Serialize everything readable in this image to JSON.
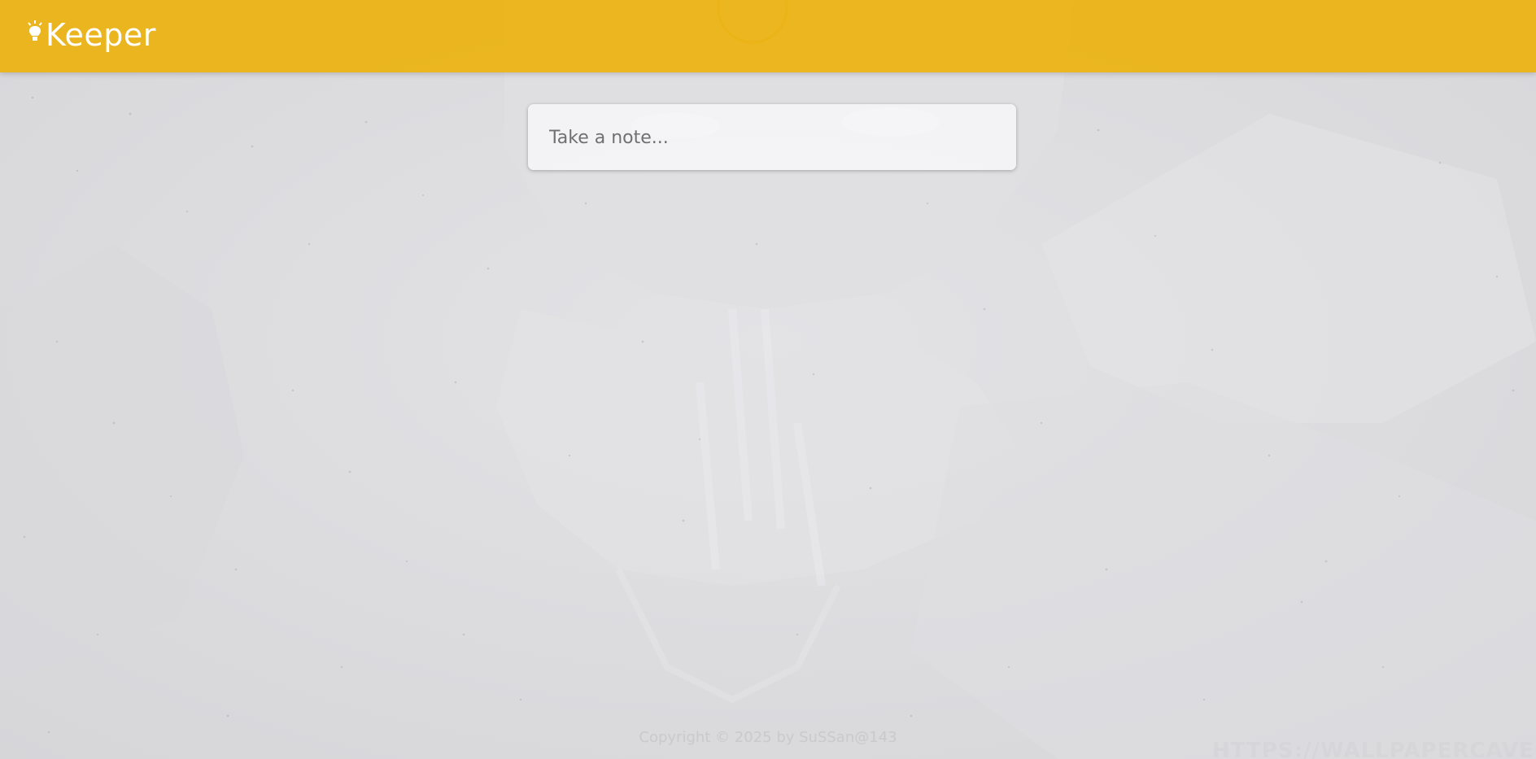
{
  "header": {
    "app_name": "Keeper",
    "logo_icon": "bulb-icon",
    "background_color": "#ECB20E"
  },
  "note": {
    "placeholder": "Take a note..."
  },
  "footer": {
    "text": "Copyright © 2025 by SuSSan@143"
  },
  "background": {
    "base_color": "#DCDCDE",
    "watermark_text": "HTTPS://WALLPAPERCAVE.COM"
  }
}
